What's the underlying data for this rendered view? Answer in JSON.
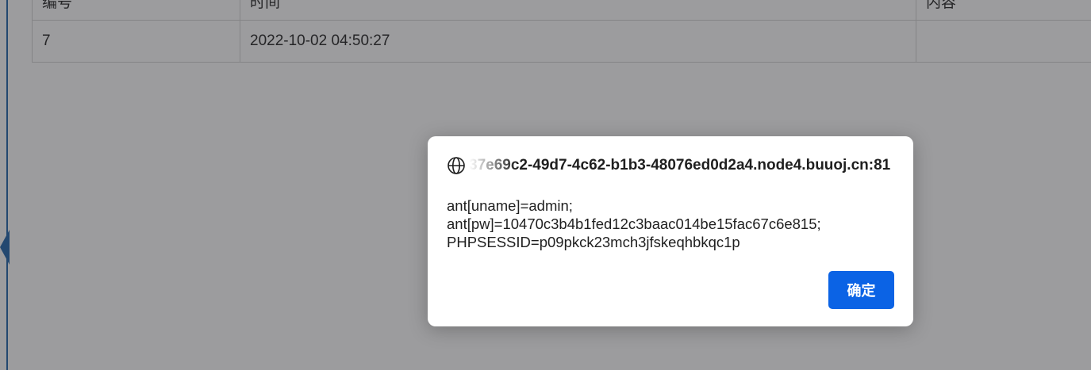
{
  "table": {
    "headers": [
      "编号",
      "时间",
      "内容"
    ],
    "rows": [
      {
        "id": "7",
        "time": "2022-10-02 04:50:27",
        "content": ""
      }
    ]
  },
  "dialog": {
    "origin": "37e69c2-49d7-4c62-b1b3-48076ed0d2a4.node4.buuoj.cn:81",
    "message_lines": [
      "ant[uname]=admin;",
      "ant[pw]=10470c3b4b1fed12c3baac014be15fac67c6e815;",
      "PHPSESSID=p09pkck23mch3jfskeqhbkqc1p"
    ],
    "ok_label": "确定"
  },
  "colors": {
    "accent": "#0b63e5",
    "sidebar": "#2f6fb0",
    "overlay": "rgba(20,20,24,0.42)"
  },
  "icons": {
    "origin": "globe-icon"
  }
}
